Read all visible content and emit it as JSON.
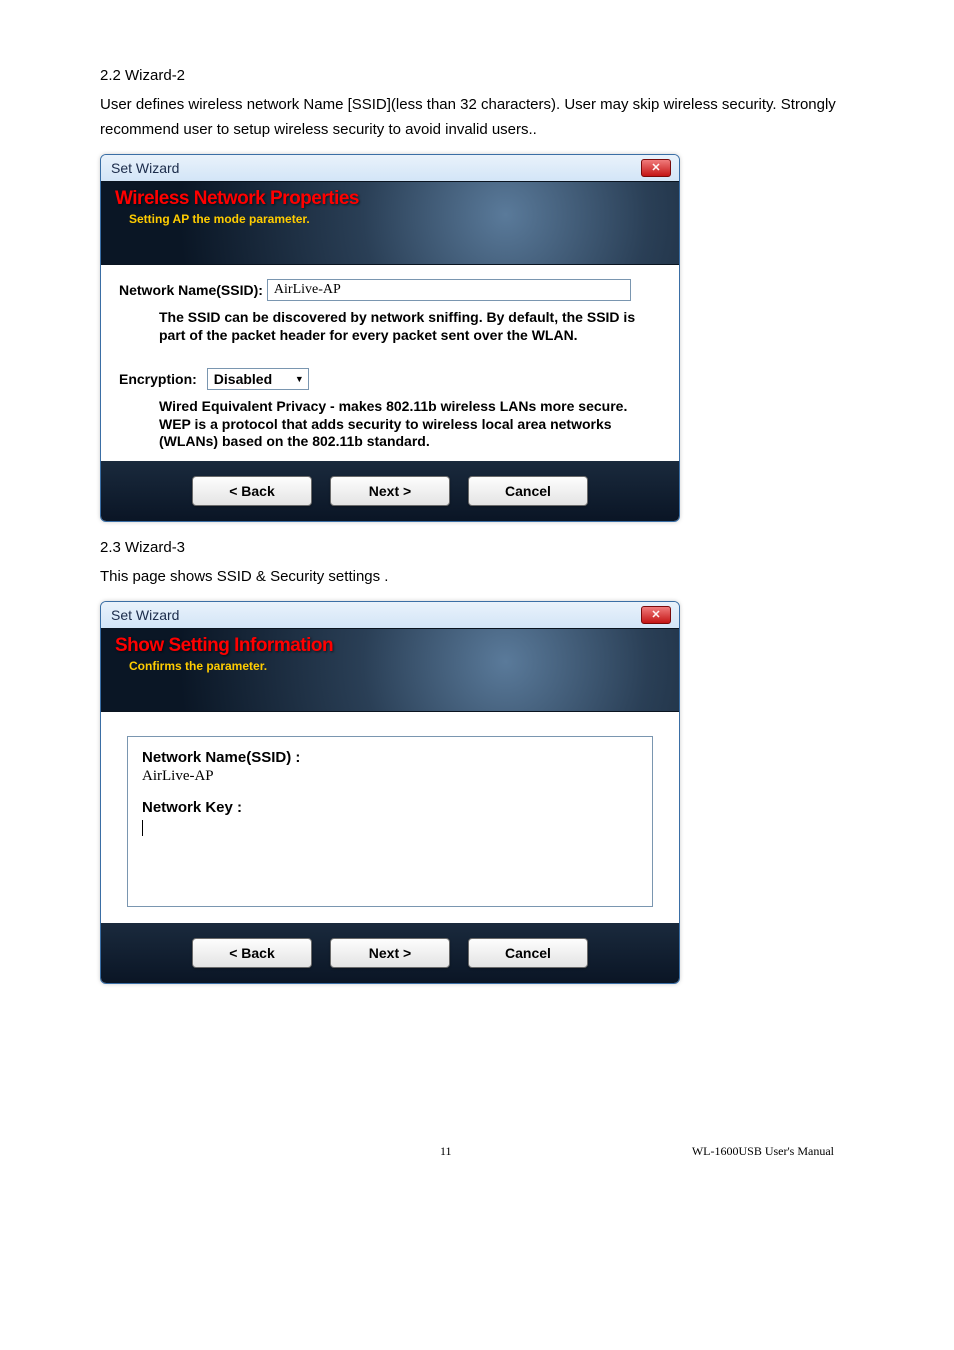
{
  "section1": {
    "heading": "2.2 Wizard-2",
    "para": "User defines wireless network Name [SSID](less than 32 characters). User may skip wireless security. Strongly recommend user to setup wireless security to avoid invalid users.."
  },
  "dialog1": {
    "title": "Set Wizard",
    "banner_title": "Wireless Network Properties",
    "banner_sub": "Setting AP the mode parameter.",
    "ssid_label": "Network Name(SSID):",
    "ssid_value": "AirLive-AP",
    "ssid_desc": "The SSID can be discovered by network sniffing. By default, the SSID is part of the packet header for every packet sent over the WLAN.",
    "enc_label": "Encryption:",
    "enc_value": "Disabled",
    "enc_desc": "Wired Equivalent Privacy - makes 802.11b wireless LANs more secure. WEP is a protocol that adds security to wireless local area networks (WLANs) based on the 802.11b standard.",
    "buttons": {
      "back": "< Back",
      "next": "Next >",
      "cancel": "Cancel"
    }
  },
  "section2": {
    "heading": "2.3 Wizard-3",
    "para": "This page shows SSID & Security settings ."
  },
  "dialog2": {
    "title": "Set Wizard",
    "banner_title": "Show Setting Information",
    "banner_sub": "Confirms the parameter.",
    "ssid_label": "Network Name(SSID) :",
    "ssid_value": "AirLive-AP",
    "key_label": "Network Key :",
    "buttons": {
      "back": "< Back",
      "next": "Next >",
      "cancel": "Cancel"
    }
  },
  "footer": {
    "page": "11",
    "doc": "WL-1600USB  User's  Manual"
  }
}
